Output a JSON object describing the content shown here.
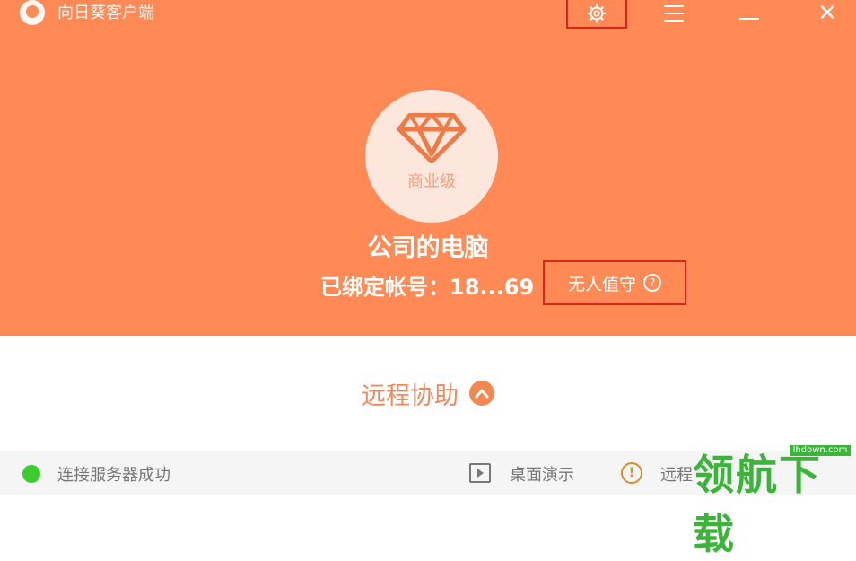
{
  "window": {
    "title": "向日葵客户端",
    "icons": {
      "settings": "gear-icon",
      "menu": "hamburger-icon",
      "minimize": "minimize-icon",
      "close": "close-icon"
    }
  },
  "device": {
    "level": "商业级",
    "name": "公司的电脑",
    "account": "已绑定帐号：18...69",
    "unattended": "无人值守"
  },
  "remote": {
    "label": "远程协助"
  },
  "status": {
    "connection": "连接服务器成功",
    "demo": "桌面演示",
    "remote_text": "远程"
  },
  "watermark": {
    "text": "领航下载",
    "url": "lhdown.com"
  },
  "colors": {
    "accent": "#ff8a55",
    "status_ok": "#3bcc2d"
  }
}
